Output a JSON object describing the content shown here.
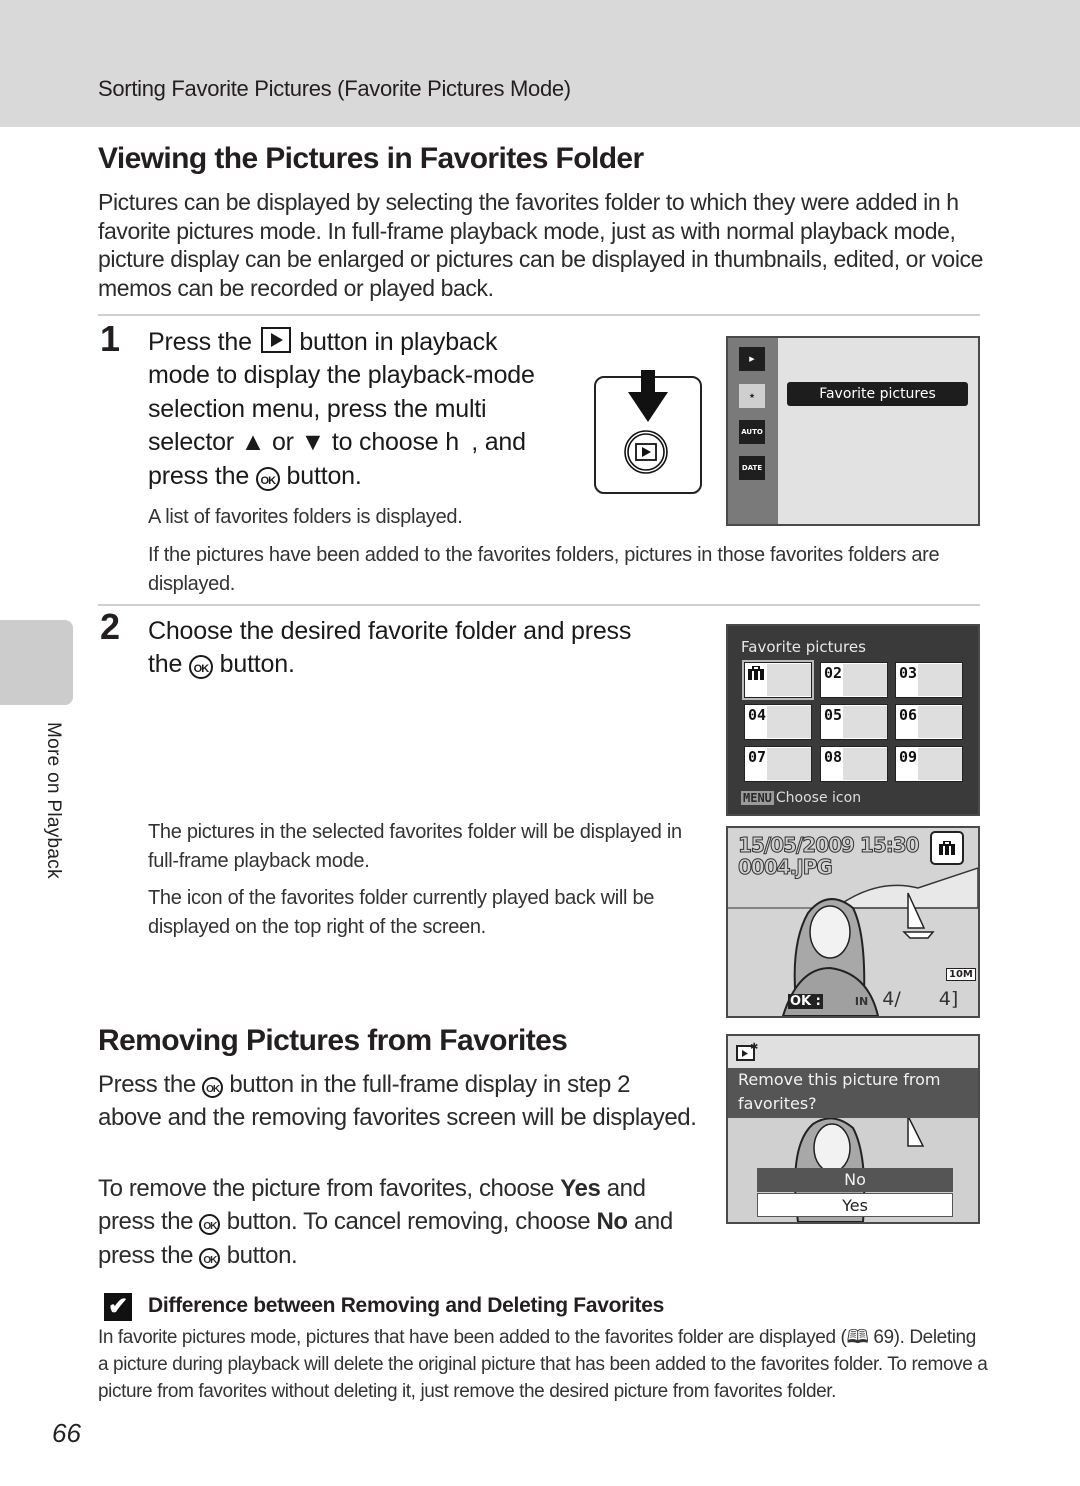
{
  "header": {
    "breadcrumb": "Sorting Favorite Pictures (Favorite Pictures Mode)"
  },
  "section1": {
    "title": "Viewing the Pictures in Favorites Folder",
    "intro": "Pictures can be displayed by selecting the favorites folder to which they were added in h favorite pictures mode. In full-frame playback mode, just as with normal playback mode, picture display can be enlarged or pictures can be displayed in thumbnails, edited, or voice memos can be recorded or played back."
  },
  "step1": {
    "number": "1",
    "line1a": "Press the",
    "line1b": "button in playback",
    "line2": "mode to display the playback-mode",
    "line3": "selection menu, press the multi",
    "line4": "selector ▲ or ▼ to choose h , and",
    "line5a": "press the",
    "line5b": "button.",
    "note1": "A list of favorites folders is displayed.",
    "note2": "If the pictures have been added to the favorites folders, pictures in those favorites folders are displayed."
  },
  "step2": {
    "number": "2",
    "line1": "Choose the desired favorite folder and press",
    "line2a": "the",
    "line2b": "button.",
    "note1": "The pictures in the selected favorites folder will be displayed in full-frame playback mode.",
    "note2": "The icon of the favorites folder currently played back will be displayed on the top right of the screen."
  },
  "ok_glyph": "OK",
  "screen_menu": {
    "mode_icons": [
      "playback-icon",
      "favorite-pictures-icon",
      "auto-sort-icon",
      "list-by-date-icon"
    ],
    "mode_labels": [
      "▶",
      "★",
      "AUTO",
      "DATE"
    ],
    "selected_item": "Favorite pictures"
  },
  "screen_folders": {
    "title": "Favorite pictures",
    "folders": [
      {
        "label": "",
        "icon": "briefcase-icon",
        "has_thumb": true,
        "selected": true
      },
      {
        "label": "02",
        "has_thumb": true
      },
      {
        "label": "03",
        "has_thumb": true
      },
      {
        "label": "04",
        "has_thumb": true
      },
      {
        "label": "05",
        "has_thumb": false
      },
      {
        "label": "06",
        "has_thumb": false
      },
      {
        "label": "07",
        "has_thumb": false
      },
      {
        "label": "08",
        "has_thumb": false
      },
      {
        "label": "09",
        "has_thumb": false
      }
    ],
    "menu_tag": "MENU",
    "footer": "Choose icon"
  },
  "screen_playback": {
    "datetime": "15/05/2009 15:30",
    "filename": "0004.JPG",
    "ok_hint": "OK :",
    "memory": "IN",
    "counter": "4/  4]",
    "image_size": "10M"
  },
  "screen_remove": {
    "question": "Remove this picture from favorites?",
    "options": [
      "No",
      "Yes"
    ],
    "selected_option": "No"
  },
  "section2": {
    "title": "Removing Pictures from Favorites",
    "p1a": "Press the",
    "p1b": "button in the full-frame display in step 2 above and the removing favorites screen will be displayed.",
    "p2a": "To remove the picture from favorites, choose",
    "p2_yes": "Yes",
    "p2b": "and press the",
    "p2c": "button. To cancel removing, choose",
    "p2_no": "No",
    "p2d": "and press the",
    "p2e": "button."
  },
  "caution": {
    "icon": "✔",
    "title": "Difference between Removing and Deleting Favorites",
    "body": "In favorite pictures mode, pictures that have been added to the favorites folder are displayed (🕮 69). Deleting a picture during playback will delete the original picture that has been added to the favorites folder. To remove a picture from favorites without deleting it, just remove the desired picture from favorites folder."
  },
  "side_tab": {
    "label": "More on Playback"
  },
  "page_number": "66"
}
